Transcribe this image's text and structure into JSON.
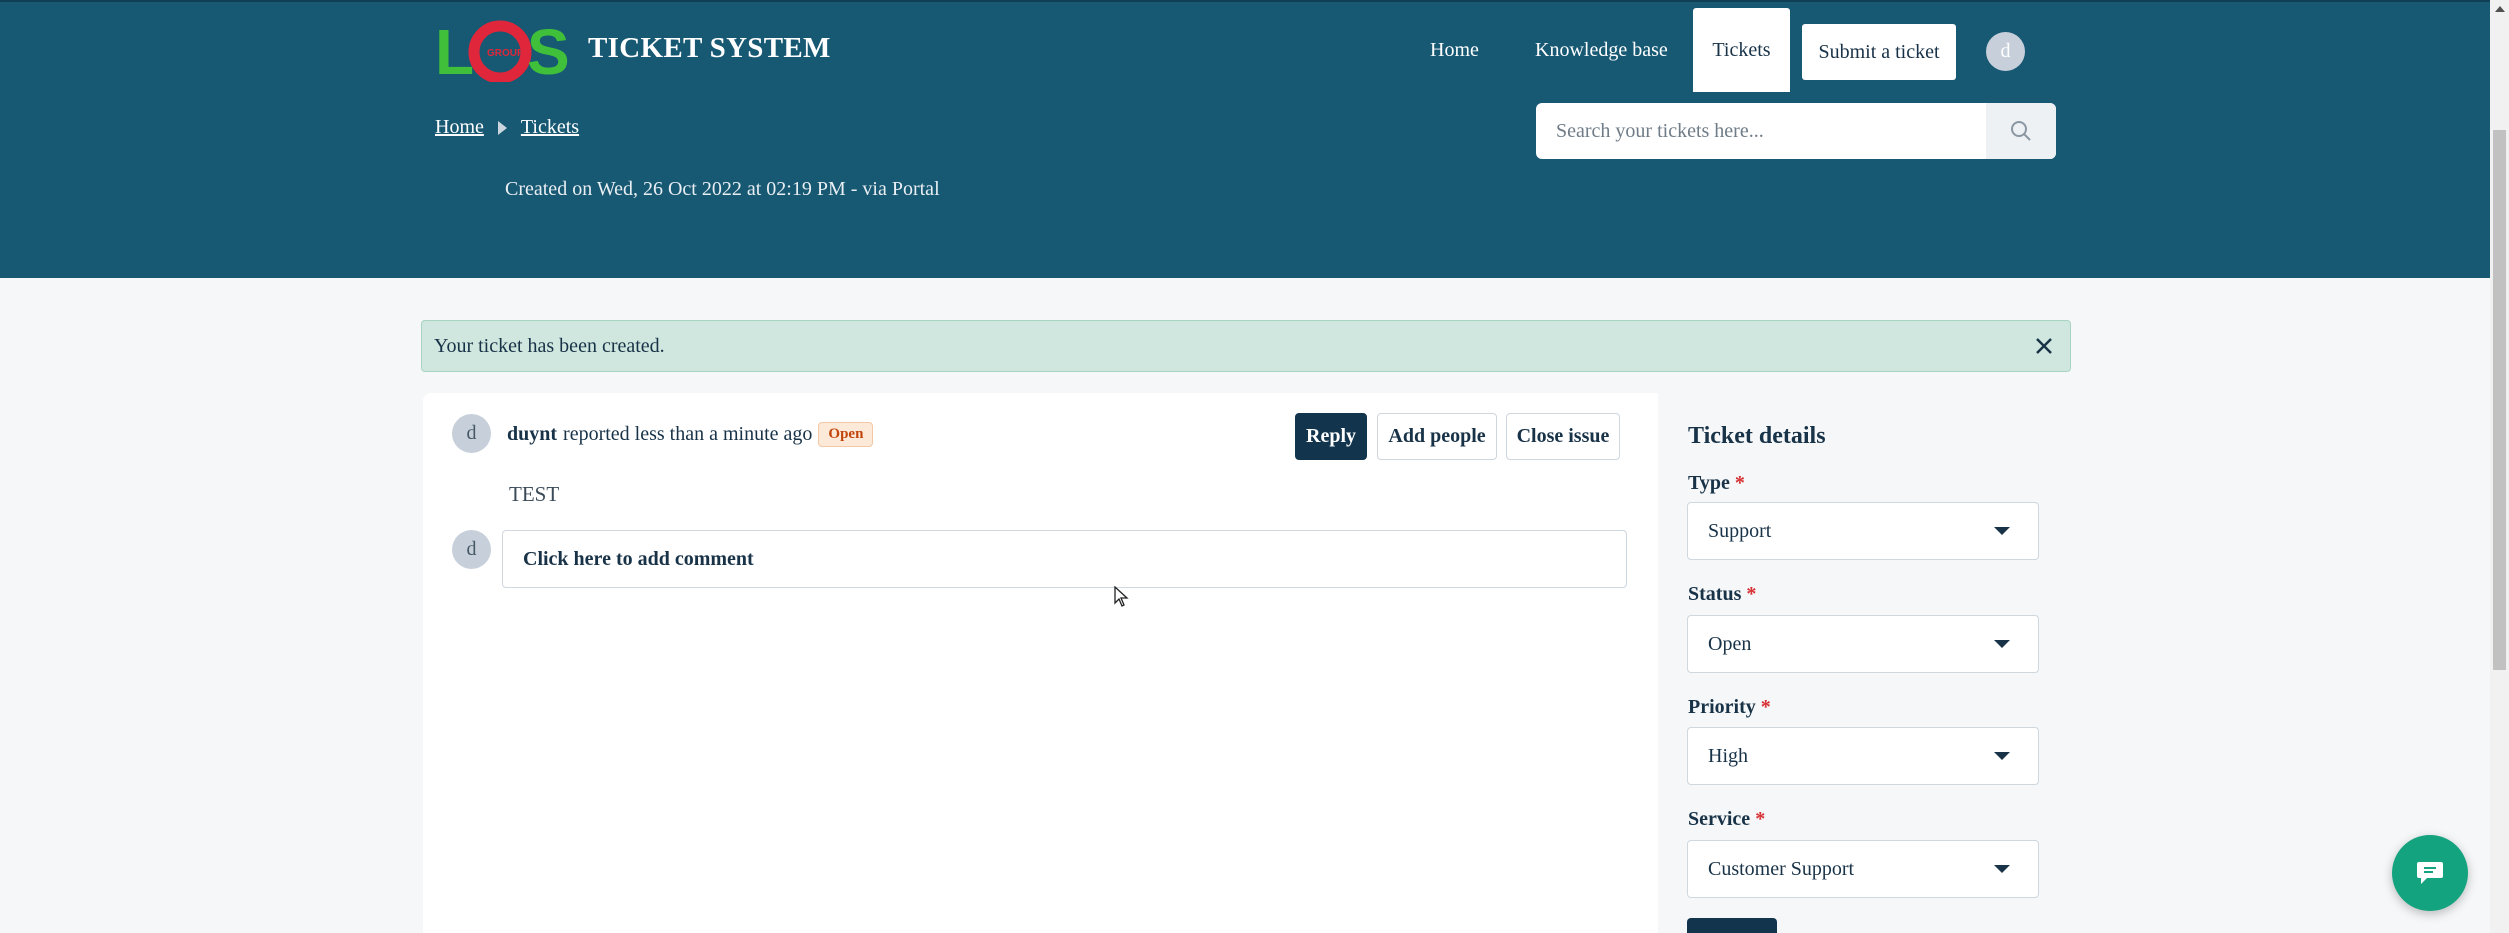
{
  "header": {
    "logo_text": "LCS",
    "logo_subtext": "GROUP",
    "brand": "TICKET SYSTEM",
    "nav": {
      "home": "Home",
      "knowledge_base": "Knowledge base",
      "tickets": "Tickets"
    },
    "submit_ticket": "Submit a ticket",
    "avatar_initial": "d",
    "breadcrumb": {
      "home": "Home",
      "tickets": "Tickets"
    },
    "search_placeholder": "Search your tickets here...",
    "created_text": "Created on Wed, 26 Oct 2022 at 02:19 PM - via Portal"
  },
  "alert": {
    "message": "Your ticket has been created."
  },
  "conversation": {
    "reporter_initial": "d",
    "reporter_name": "duynt",
    "reported_text": "reported less than a minute ago",
    "status_badge": "Open",
    "actions": {
      "reply": "Reply",
      "add_people": "Add people",
      "close_issue": "Close issue"
    },
    "description": "TEST",
    "comment_avatar_initial": "d",
    "comment_prompt": "Click here to add comment"
  },
  "ticket_details": {
    "title": "Ticket details",
    "required_mark": "*",
    "fields": [
      {
        "label": "Type",
        "value": "Support"
      },
      {
        "label": "Status",
        "value": "Open"
      },
      {
        "label": "Priority",
        "value": "High"
      },
      {
        "label": "Service",
        "value": "Customer Support"
      }
    ]
  },
  "colors": {
    "header_bg": "#175873",
    "alert_bg": "#cfe7de",
    "primary_button": "#12344d",
    "badge_text": "#c2450c",
    "chat_button": "#14a37f",
    "required": "#d72d30"
  },
  "icons": [
    "search-icon",
    "close-icon",
    "chevron-right-icon",
    "chevron-down-icon",
    "chat-icon",
    "mouse-cursor-icon"
  ]
}
